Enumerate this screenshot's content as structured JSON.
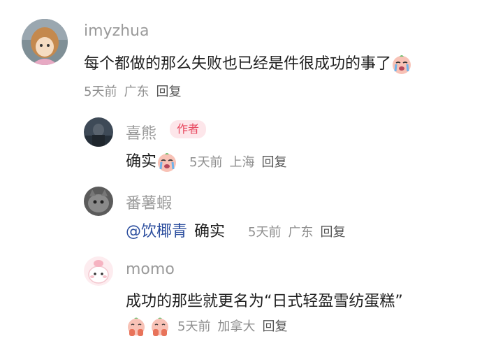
{
  "comments": [
    {
      "username": "imyzhua",
      "text": "每个都做的那么失败也已经是件很成功的事了",
      "emoji": "crying-face-emoji",
      "time": "5天前",
      "location": "广东",
      "reply_label": "回复",
      "replies": [
        {
          "username": "喜熊",
          "badge": "作者",
          "text": "确实",
          "emoji": "crying-face-emoji",
          "time": "5天前",
          "location": "上海",
          "reply_label": "回复"
        },
        {
          "username": "番薯蝦",
          "mention": "@饮椰青",
          "text": "确实",
          "time": "5天前",
          "location": "广东",
          "reply_label": "回复"
        },
        {
          "username": "momo",
          "text": "成功的那些就更名为“日式轻盈雪纺蛋糕”",
          "emojis": [
            "praying-face-emoji",
            "praying-face-emoji"
          ],
          "time": "5天前",
          "location": "加拿大",
          "reply_label": "回复"
        }
      ]
    }
  ],
  "colors": {
    "name": "#9a9a9a",
    "meta": "#8f8f8f",
    "badge_text": "#e8485f",
    "badge_bg": "#fde6ea",
    "mention": "#2c4e9e"
  }
}
